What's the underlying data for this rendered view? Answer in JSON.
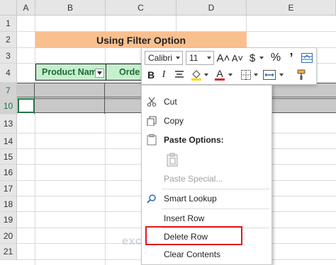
{
  "columns": [
    "A",
    "B",
    "C",
    "D",
    "E"
  ],
  "rows": [
    "1",
    "2",
    "3",
    "4",
    "7",
    "10",
    "13",
    "14",
    "15",
    "16",
    "17",
    "18",
    "19",
    "20",
    "21"
  ],
  "sheet": {
    "title": "Using Filter Option",
    "header_product": "Product Nam",
    "header_order": "Orde",
    "colors": {
      "title_fill": "#f9c08f",
      "header_fill": "#c6efce",
      "header_text": "#1e6b30",
      "selected_row": "#c8c8c8"
    }
  },
  "minitoolbar": {
    "font_name": "Calibri",
    "font_size": "11",
    "grow_font": "A˄",
    "shrink_font": "A˅",
    "currency": "$",
    "percent": "%",
    "comma": "’",
    "bold": "B",
    "italic": "I",
    "font_color_label": "A"
  },
  "menu": {
    "cut": "Cut",
    "copy": "Copy",
    "paste_options": "Paste Options:",
    "paste_special": "Paste Special...",
    "smart_lookup": "Smart Lookup",
    "insert_row": "Insert Row",
    "delete_row": "Delete Row",
    "clear_contents": "Clear Contents"
  },
  "watermark": "exceldemy"
}
